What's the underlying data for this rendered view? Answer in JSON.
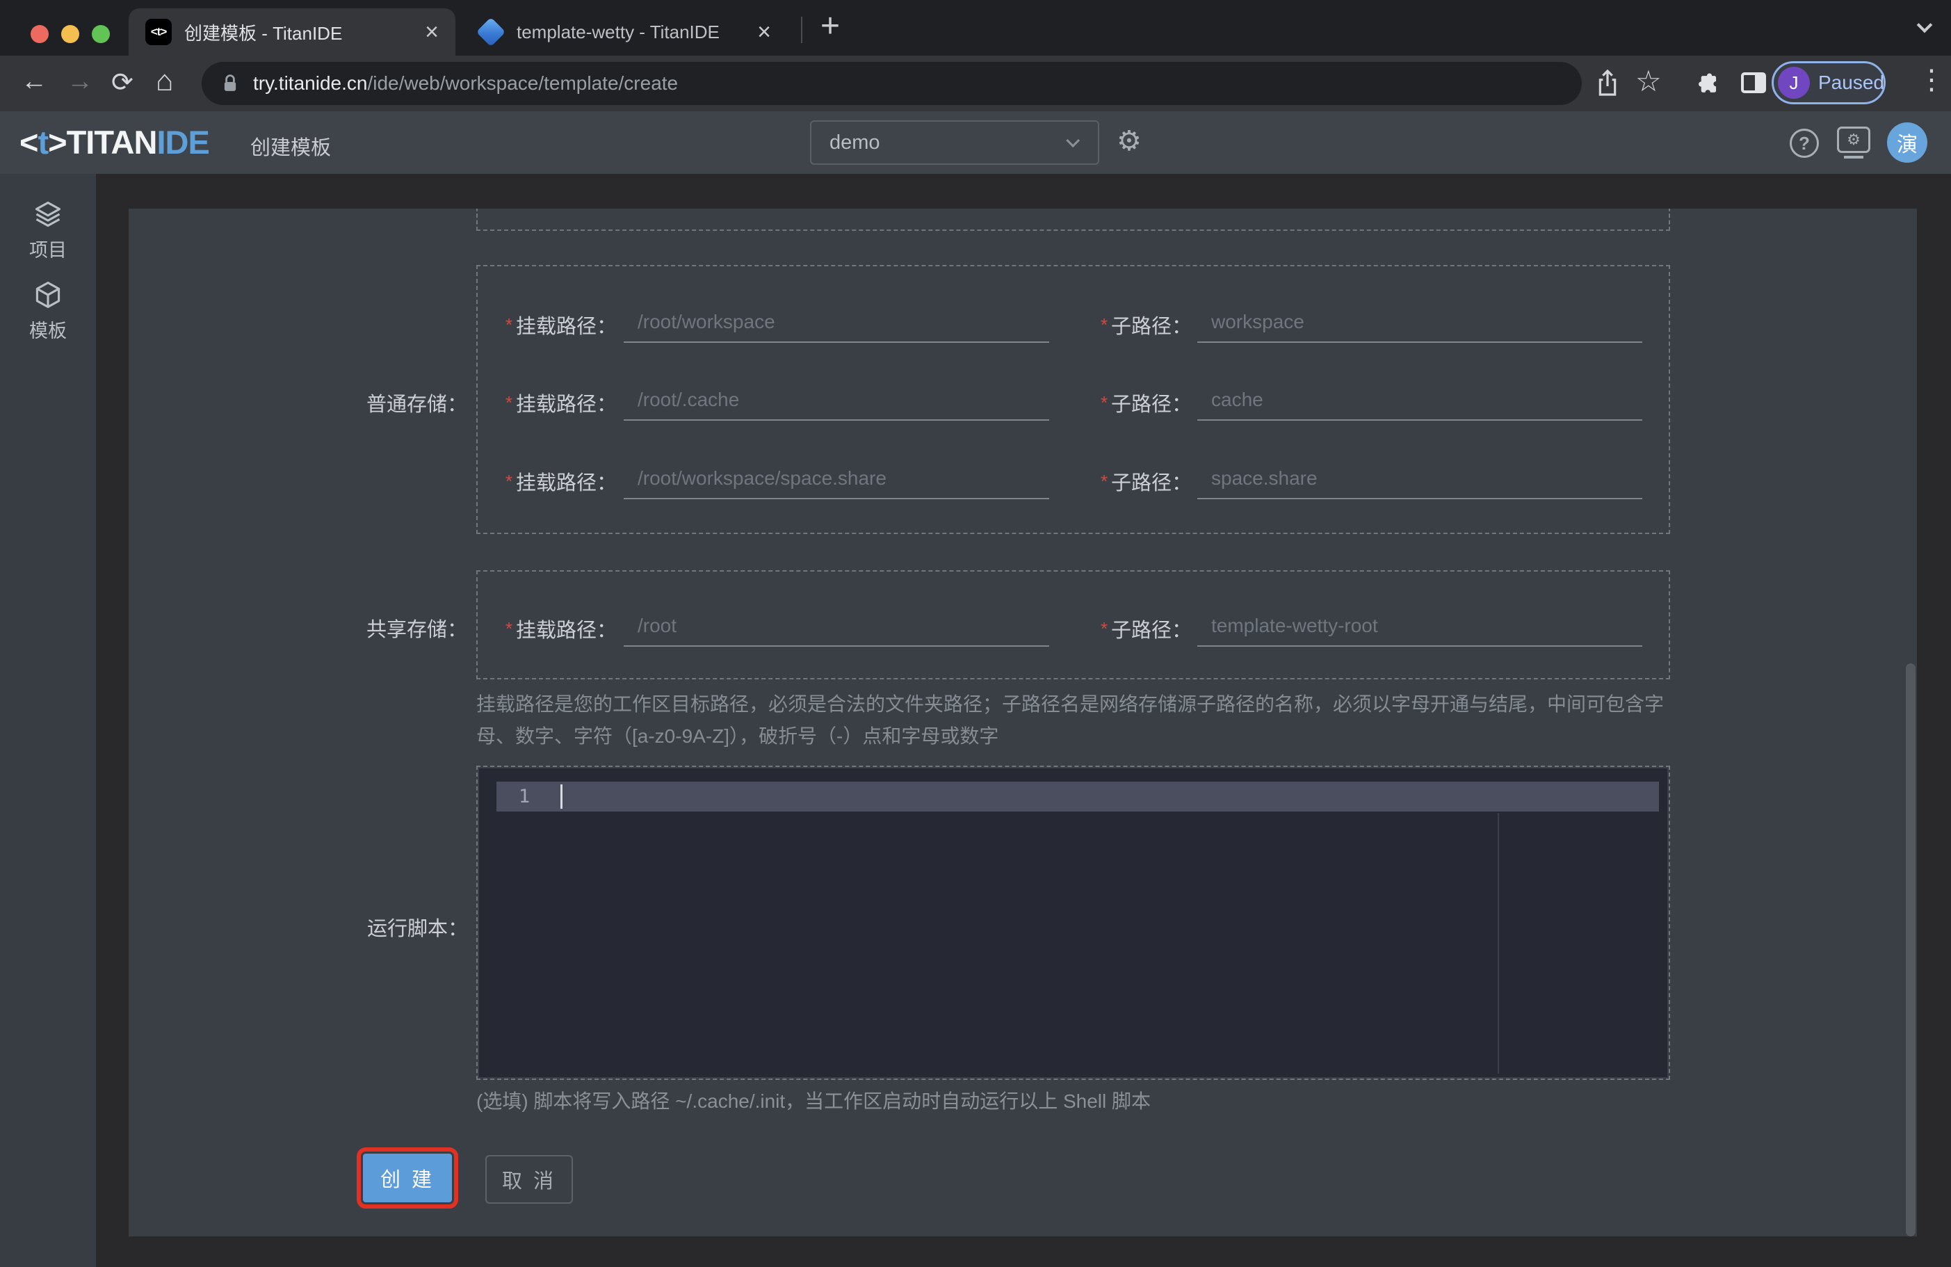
{
  "browser": {
    "tabs": [
      {
        "title": "创建模板 - TitanIDE",
        "favicon_text": "<t>"
      },
      {
        "title": "template-wetty - TitanIDE"
      }
    ],
    "close_glyph": "×",
    "new_tab_glyph": "+",
    "nav": {
      "back": "←",
      "forward": "→",
      "reload": "⟳",
      "home": "⌂"
    },
    "url": {
      "host": "try.titanide.cn",
      "path": "/ide/web/workspace/template/create"
    },
    "actions": {
      "bookmark_star": "☆",
      "menu_dots": "⋮"
    },
    "profile": {
      "initial": "J",
      "status": "Paused"
    }
  },
  "header": {
    "logo": {
      "open": "<",
      "t": "t",
      "close": ">",
      "titan": "TITAN",
      "ide": "IDE"
    },
    "page_title": "创建模板",
    "workspace_select": {
      "value": "demo"
    },
    "gear_glyph": "⚙",
    "help_glyph": "?",
    "sys_gear_glyph": "⚙",
    "avatar_text": "演"
  },
  "sidebar": {
    "items": [
      {
        "label": "项目"
      },
      {
        "label": "模板"
      }
    ]
  },
  "form": {
    "required_marker": "*",
    "mount_label": "挂载路径：",
    "sub_label": "子路径：",
    "normal_storage": {
      "label": "普通存储：",
      "rows": [
        {
          "mount_placeholder": "/root/workspace",
          "sub_placeholder": "workspace"
        },
        {
          "mount_placeholder": "/root/.cache",
          "sub_placeholder": "cache"
        },
        {
          "mount_placeholder": "/root/workspace/space.share",
          "sub_placeholder": "space.share"
        }
      ]
    },
    "shared_storage": {
      "label": "共享存储：",
      "rows": [
        {
          "mount_placeholder": "/root",
          "sub_placeholder": "template-wetty-root"
        }
      ]
    },
    "path_hint": "挂载路径是您的工作区目标路径，必须是合法的文件夹路径；子路径名是网络存储源子路径的名称，必须以字母开通与结尾，中间可包含字母、数字、字符（[a-z0-9A-Z]），破折号（-）点和字母或数字",
    "script_label": "运行脚本：",
    "editor": {
      "line_number": "1"
    },
    "script_hint": "(选填) 脚本将写入路径 ~/.cache/.init，当工作区启动时自动运行以上 Shell 脚本",
    "buttons": {
      "create": "创 建",
      "cancel": "取 消"
    }
  },
  "colors": {
    "accent_blue": "#5c9cd8",
    "highlight_red": "#e23122",
    "avatar_blue": "#68a5dc",
    "profile_purple": "#7147c1",
    "paused_text": "#abc7f7"
  }
}
